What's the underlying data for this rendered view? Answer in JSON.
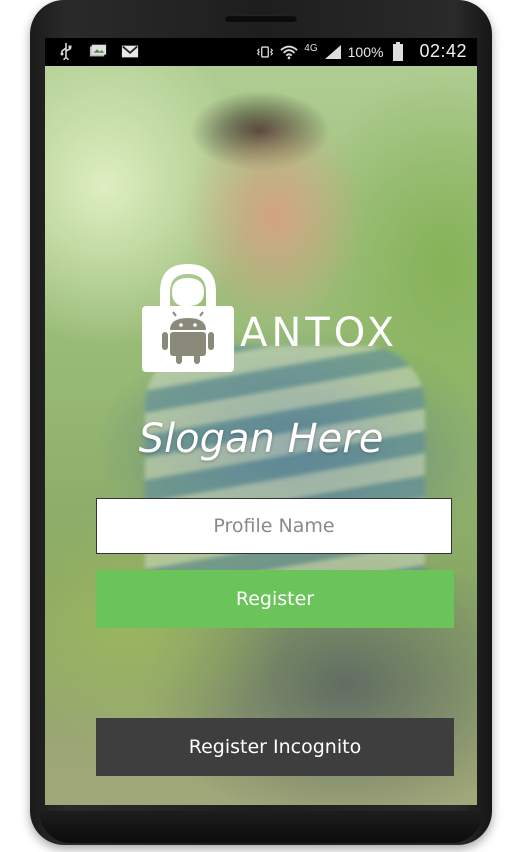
{
  "status_bar": {
    "left_icons": [
      "usb-icon",
      "photo-icon",
      "gmail-icon"
    ],
    "right_icons": [
      "vibrate-icon",
      "wifi-icon",
      "4g-icon",
      "signal-icon",
      "battery-icon"
    ],
    "network_type": "4G",
    "battery": "100%",
    "time": "02:42"
  },
  "logo": {
    "icon": "lock-android-icon",
    "text": "ANTOX"
  },
  "slogan": "Slogan Here",
  "form": {
    "profile_placeholder": "Profile Name",
    "profile_value": ""
  },
  "buttons": {
    "register": "Register",
    "register_incognito": "Register Incognito"
  },
  "colors": {
    "register": "#6ac45a",
    "incognito": "#3e3e3e",
    "text": "#ffffff"
  }
}
